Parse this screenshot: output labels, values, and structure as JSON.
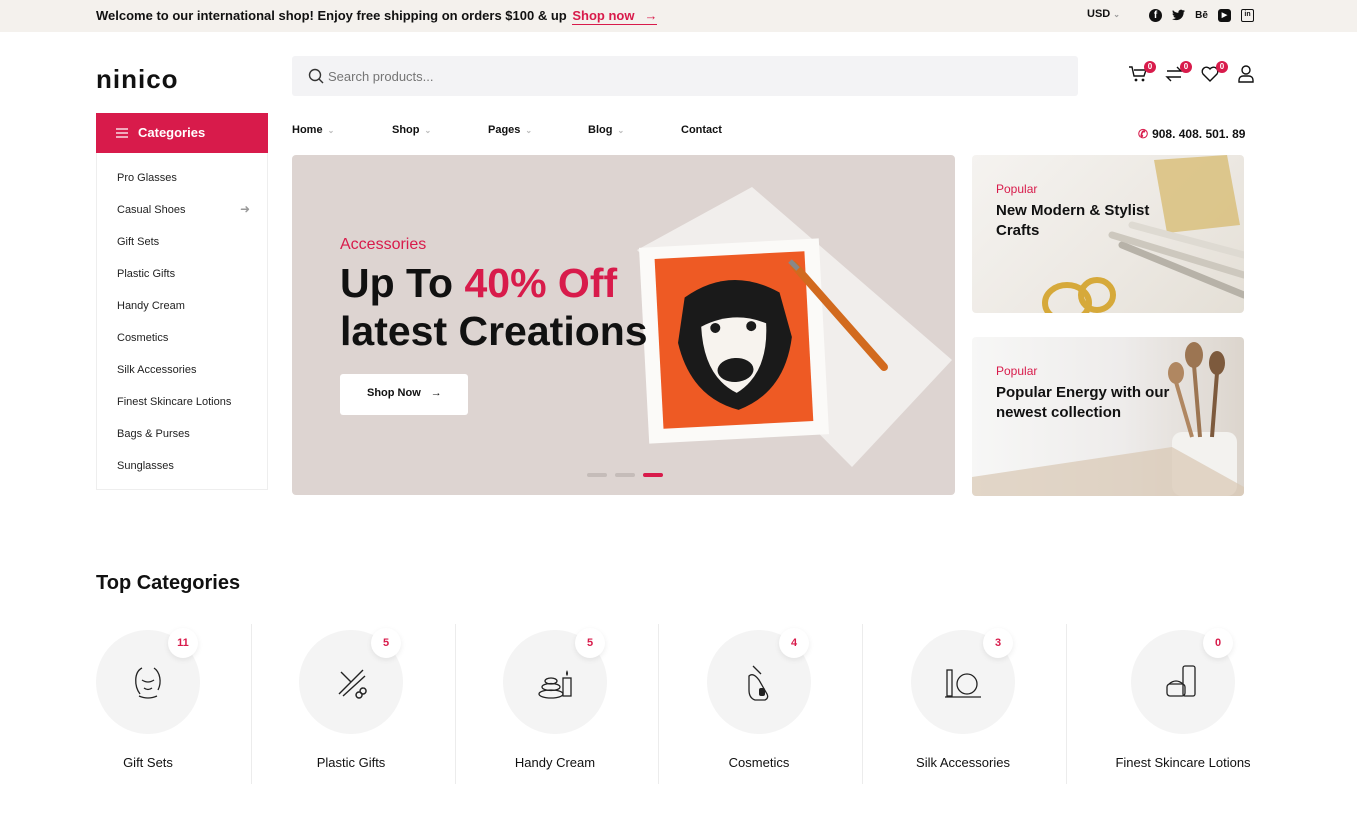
{
  "topbar": {
    "message": "Welcome to our international shop! Enjoy free shipping on orders $100 & up",
    "shop_link": "Shop now",
    "arrow": "→",
    "currency": "USD",
    "socials": [
      "facebook-icon",
      "twitter-icon",
      "behance-icon",
      "youtube-icon",
      "linkedin-icon"
    ],
    "behance_text": "Bē"
  },
  "header": {
    "logo": "ninico",
    "search_placeholder": "Search products...",
    "cart_count": "0",
    "compare_count": "0",
    "wishlist_count": "0"
  },
  "categories": {
    "title": "Categories",
    "items": [
      "Pro Glasses",
      "Casual Shoes",
      "Gift Sets",
      "Plastic Gifts",
      "Handy Cream",
      "Cosmetics",
      "Silk Accessories",
      "Finest Skincare Lotions",
      "Bags & Purses",
      "Sunglasses"
    ]
  },
  "nav": {
    "items": [
      "Home",
      "Shop",
      "Pages",
      "Blog",
      "Contact"
    ],
    "phone": "908. 408. 501. 89"
  },
  "hero": {
    "subtitle": "Accessories",
    "title_pre": "Up To ",
    "title_highlight": "40% Off",
    "title_line2": "latest Creations",
    "button": "Shop Now",
    "slide_count": 3,
    "active_slide": 3
  },
  "banners": [
    {
      "tag": "Popular",
      "title": "New Modern & Stylist Crafts"
    },
    {
      "tag": "Popular",
      "title": "Popular Energy with our newest collection"
    }
  ],
  "top_categories": {
    "title": "Top Categories",
    "items": [
      {
        "label": "Gift Sets",
        "count": "11",
        "icon": "face-care-icon"
      },
      {
        "label": "Plastic Gifts",
        "count": "5",
        "icon": "scissors-comb-icon"
      },
      {
        "label": "Handy Cream",
        "count": "5",
        "icon": "spa-stones-icon"
      },
      {
        "label": "Cosmetics",
        "count": "4",
        "icon": "nail-polish-icon"
      },
      {
        "label": "Silk Accessories",
        "count": "3",
        "icon": "makeup-mirror-icon"
      },
      {
        "label": "Finest Skincare Lotions",
        "count": "0",
        "icon": "cream-jar-icon"
      }
    ]
  },
  "colors": {
    "accent": "#d81b4b",
    "topbar": "#f4f1ed",
    "hero_bg": "#ddd4d1"
  }
}
